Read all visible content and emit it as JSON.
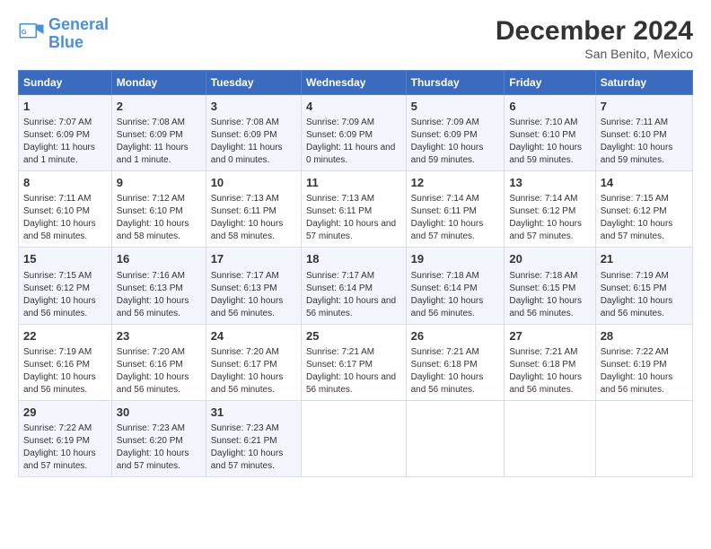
{
  "logo": {
    "line1": "General",
    "line2": "Blue"
  },
  "title": "December 2024",
  "location": "San Benito, Mexico",
  "days_of_week": [
    "Sunday",
    "Monday",
    "Tuesday",
    "Wednesday",
    "Thursday",
    "Friday",
    "Saturday"
  ],
  "weeks": [
    [
      {
        "day": "1",
        "sunrise": "7:07 AM",
        "sunset": "6:09 PM",
        "daylight": "11 hours and 1 minute."
      },
      {
        "day": "2",
        "sunrise": "7:08 AM",
        "sunset": "6:09 PM",
        "daylight": "11 hours and 1 minute."
      },
      {
        "day": "3",
        "sunrise": "7:08 AM",
        "sunset": "6:09 PM",
        "daylight": "11 hours and 0 minutes."
      },
      {
        "day": "4",
        "sunrise": "7:09 AM",
        "sunset": "6:09 PM",
        "daylight": "11 hours and 0 minutes."
      },
      {
        "day": "5",
        "sunrise": "7:09 AM",
        "sunset": "6:09 PM",
        "daylight": "10 hours and 59 minutes."
      },
      {
        "day": "6",
        "sunrise": "7:10 AM",
        "sunset": "6:10 PM",
        "daylight": "10 hours and 59 minutes."
      },
      {
        "day": "7",
        "sunrise": "7:11 AM",
        "sunset": "6:10 PM",
        "daylight": "10 hours and 59 minutes."
      }
    ],
    [
      {
        "day": "8",
        "sunrise": "7:11 AM",
        "sunset": "6:10 PM",
        "daylight": "10 hours and 58 minutes."
      },
      {
        "day": "9",
        "sunrise": "7:12 AM",
        "sunset": "6:10 PM",
        "daylight": "10 hours and 58 minutes."
      },
      {
        "day": "10",
        "sunrise": "7:13 AM",
        "sunset": "6:11 PM",
        "daylight": "10 hours and 58 minutes."
      },
      {
        "day": "11",
        "sunrise": "7:13 AM",
        "sunset": "6:11 PM",
        "daylight": "10 hours and 57 minutes."
      },
      {
        "day": "12",
        "sunrise": "7:14 AM",
        "sunset": "6:11 PM",
        "daylight": "10 hours and 57 minutes."
      },
      {
        "day": "13",
        "sunrise": "7:14 AM",
        "sunset": "6:12 PM",
        "daylight": "10 hours and 57 minutes."
      },
      {
        "day": "14",
        "sunrise": "7:15 AM",
        "sunset": "6:12 PM",
        "daylight": "10 hours and 57 minutes."
      }
    ],
    [
      {
        "day": "15",
        "sunrise": "7:15 AM",
        "sunset": "6:12 PM",
        "daylight": "10 hours and 56 minutes."
      },
      {
        "day": "16",
        "sunrise": "7:16 AM",
        "sunset": "6:13 PM",
        "daylight": "10 hours and 56 minutes."
      },
      {
        "day": "17",
        "sunrise": "7:17 AM",
        "sunset": "6:13 PM",
        "daylight": "10 hours and 56 minutes."
      },
      {
        "day": "18",
        "sunrise": "7:17 AM",
        "sunset": "6:14 PM",
        "daylight": "10 hours and 56 minutes."
      },
      {
        "day": "19",
        "sunrise": "7:18 AM",
        "sunset": "6:14 PM",
        "daylight": "10 hours and 56 minutes."
      },
      {
        "day": "20",
        "sunrise": "7:18 AM",
        "sunset": "6:15 PM",
        "daylight": "10 hours and 56 minutes."
      },
      {
        "day": "21",
        "sunrise": "7:19 AM",
        "sunset": "6:15 PM",
        "daylight": "10 hours and 56 minutes."
      }
    ],
    [
      {
        "day": "22",
        "sunrise": "7:19 AM",
        "sunset": "6:16 PM",
        "daylight": "10 hours and 56 minutes."
      },
      {
        "day": "23",
        "sunrise": "7:20 AM",
        "sunset": "6:16 PM",
        "daylight": "10 hours and 56 minutes."
      },
      {
        "day": "24",
        "sunrise": "7:20 AM",
        "sunset": "6:17 PM",
        "daylight": "10 hours and 56 minutes."
      },
      {
        "day": "25",
        "sunrise": "7:21 AM",
        "sunset": "6:17 PM",
        "daylight": "10 hours and 56 minutes."
      },
      {
        "day": "26",
        "sunrise": "7:21 AM",
        "sunset": "6:18 PM",
        "daylight": "10 hours and 56 minutes."
      },
      {
        "day": "27",
        "sunrise": "7:21 AM",
        "sunset": "6:18 PM",
        "daylight": "10 hours and 56 minutes."
      },
      {
        "day": "28",
        "sunrise": "7:22 AM",
        "sunset": "6:19 PM",
        "daylight": "10 hours and 56 minutes."
      }
    ],
    [
      {
        "day": "29",
        "sunrise": "7:22 AM",
        "sunset": "6:19 PM",
        "daylight": "10 hours and 57 minutes."
      },
      {
        "day": "30",
        "sunrise": "7:23 AM",
        "sunset": "6:20 PM",
        "daylight": "10 hours and 57 minutes."
      },
      {
        "day": "31",
        "sunrise": "7:23 AM",
        "sunset": "6:21 PM",
        "daylight": "10 hours and 57 minutes."
      },
      null,
      null,
      null,
      null
    ]
  ],
  "labels": {
    "sunrise": "Sunrise:",
    "sunset": "Sunset:",
    "daylight": "Daylight:"
  }
}
